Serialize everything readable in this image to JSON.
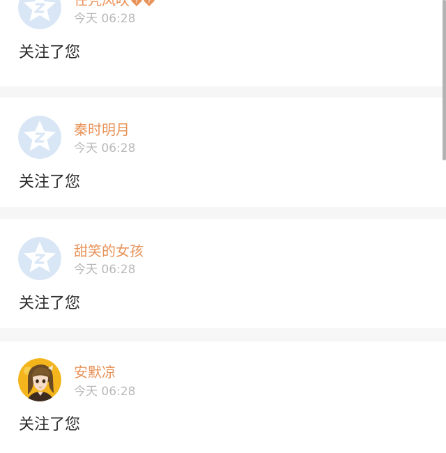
{
  "notifications": [
    {
      "username": "任凭风吹",
      "username_glyphs": [
        "unknown-char-glyph",
        "unknown-char-glyph"
      ],
      "time": "今天 06:28",
      "message": "关注了您",
      "avatar": "default-qzone-star-avatar"
    },
    {
      "username": "秦时明月",
      "time": "今天 06:28",
      "message": "关注了您",
      "avatar": "default-qzone-star-avatar"
    },
    {
      "username": "甜笑的女孩",
      "time": "今天 06:28",
      "message": "关注了您",
      "avatar": "default-qzone-star-avatar"
    },
    {
      "username": "安默凉",
      "time": "今天 06:28",
      "message": "关注了您",
      "avatar": "anime-girl-photo-avatar"
    }
  ],
  "colors": {
    "username": "#e8935a",
    "timestamp": "#b9b9b9",
    "message": "#2b2b2b",
    "separator": "#f7f6f6",
    "default_avatar_bg": "#d9e6f5",
    "glyph_badge": "#e8935a"
  }
}
